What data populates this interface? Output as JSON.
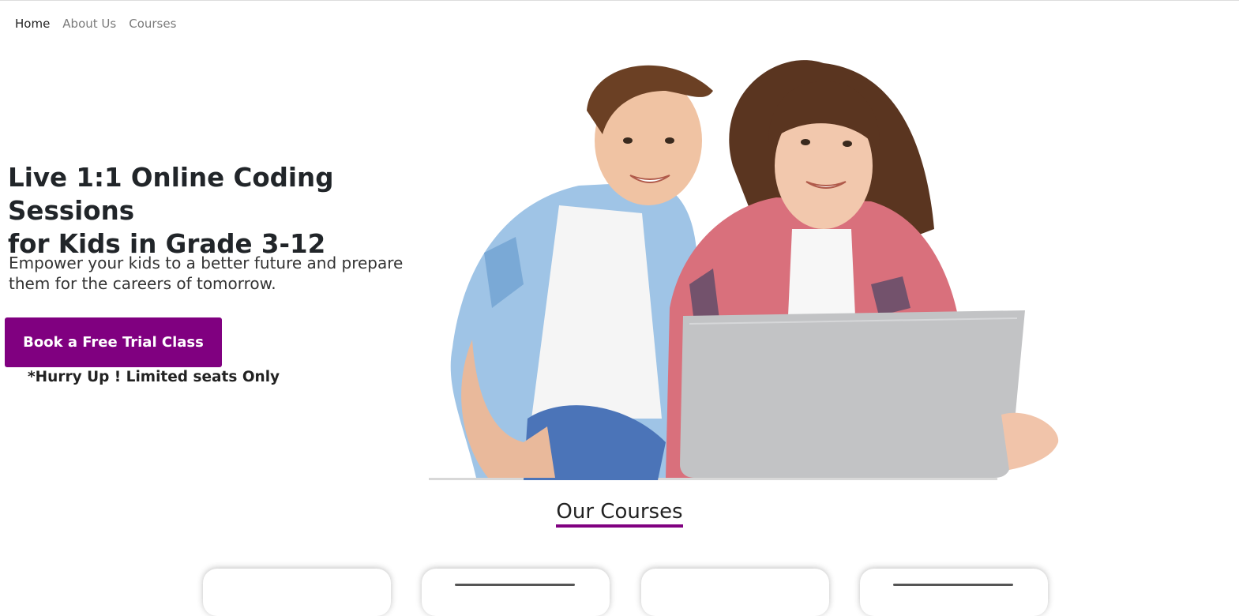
{
  "nav": {
    "items": [
      {
        "label": "Home",
        "active": true
      },
      {
        "label": "About Us",
        "active": false
      },
      {
        "label": "Courses",
        "active": false
      }
    ]
  },
  "hero": {
    "title_line1": "Live 1:1 Online Coding Sessions",
    "title_line2": "for Kids in Grade 3-12",
    "subtitle_line1": "Empower your kids to a better future and prepare",
    "subtitle_line2": "them for the careers of tomorrow.",
    "cta_label": "Book a Free Trial Class",
    "note": "*Hurry Up ! Limited seats Only"
  },
  "courses": {
    "heading": "Our Courses",
    "card_count": 4
  },
  "colors": {
    "accent": "#800080",
    "text": "#212529",
    "nav_inactive": "#7a7a7a"
  }
}
